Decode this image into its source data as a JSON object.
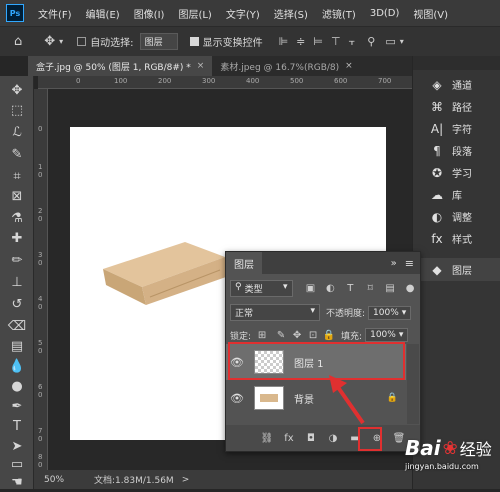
{
  "app": {
    "logo": "Ps"
  },
  "menu": [
    "文件(F)",
    "编辑(E)",
    "图像(I)",
    "图层(L)",
    "文字(Y)",
    "选择(S)",
    "滤镜(T)",
    "3D(D)",
    "视图(V)"
  ],
  "options": {
    "auto_select_label": "自动选择:",
    "auto_select_value": "图层",
    "show_transform_label": "显示变换控件"
  },
  "tabs": [
    {
      "label": "盒子.jpg @ 50% (图层 1, RGB/8#) *",
      "close": "×"
    },
    {
      "label": "素材.jpeg @ 16.7%(RGB/8)",
      "close": "×"
    }
  ],
  "ruler": {
    "h": [
      "0",
      "100",
      "200",
      "300",
      "400",
      "500",
      "600",
      "700"
    ],
    "v": [
      "0",
      "1",
      "0",
      "2",
      "0",
      "3",
      "0",
      "4",
      "0",
      "5",
      "0",
      "6",
      "0",
      "7",
      "0",
      "8",
      "0"
    ]
  },
  "status": {
    "zoom": "50%",
    "doc": "文档:1.83M/1.56M",
    "arrow": ">"
  },
  "right_panel": [
    {
      "icon": "channels-icon",
      "glyph": "◈",
      "label": "通道"
    },
    {
      "icon": "paths-icon",
      "glyph": "⌘",
      "label": "路径"
    },
    {
      "icon": "character-icon",
      "glyph": "A|",
      "label": "字符"
    },
    {
      "icon": "paragraph-icon",
      "glyph": "¶",
      "label": "段落"
    },
    {
      "icon": "learn-icon",
      "glyph": "✪",
      "label": "学习"
    },
    {
      "icon": "libraries-icon",
      "glyph": "☁",
      "label": "库"
    },
    {
      "icon": "adjustments-icon",
      "glyph": "◐",
      "label": "调整"
    },
    {
      "icon": "styles-icon",
      "glyph": "fx",
      "label": "样式"
    },
    {
      "icon": "layers-icon",
      "glyph": "◆",
      "label": "图层"
    }
  ],
  "layers_panel": {
    "tab": "图层",
    "menu_glyph": "≡",
    "expand_glyph": "»",
    "kind_label": "类型",
    "blend_mode": "正常",
    "opacity_label": "不透明度:",
    "opacity_value": "100%",
    "lock_label": "锁定:",
    "fill_label": "填充:",
    "fill_value": "100%",
    "layers": [
      {
        "name": "图层 1"
      },
      {
        "name": "背景"
      }
    ],
    "footer": [
      "link-icon",
      "fx",
      "mask-icon",
      "adjustment-icon",
      "folder-icon",
      "new-layer-icon",
      "trash-icon"
    ]
  },
  "watermark": {
    "text": "Bai",
    "text2": "经验",
    "url": "jingyan.baidu.com"
  },
  "colors": {
    "highlight": "#e03030",
    "box": "#d9b88d"
  }
}
